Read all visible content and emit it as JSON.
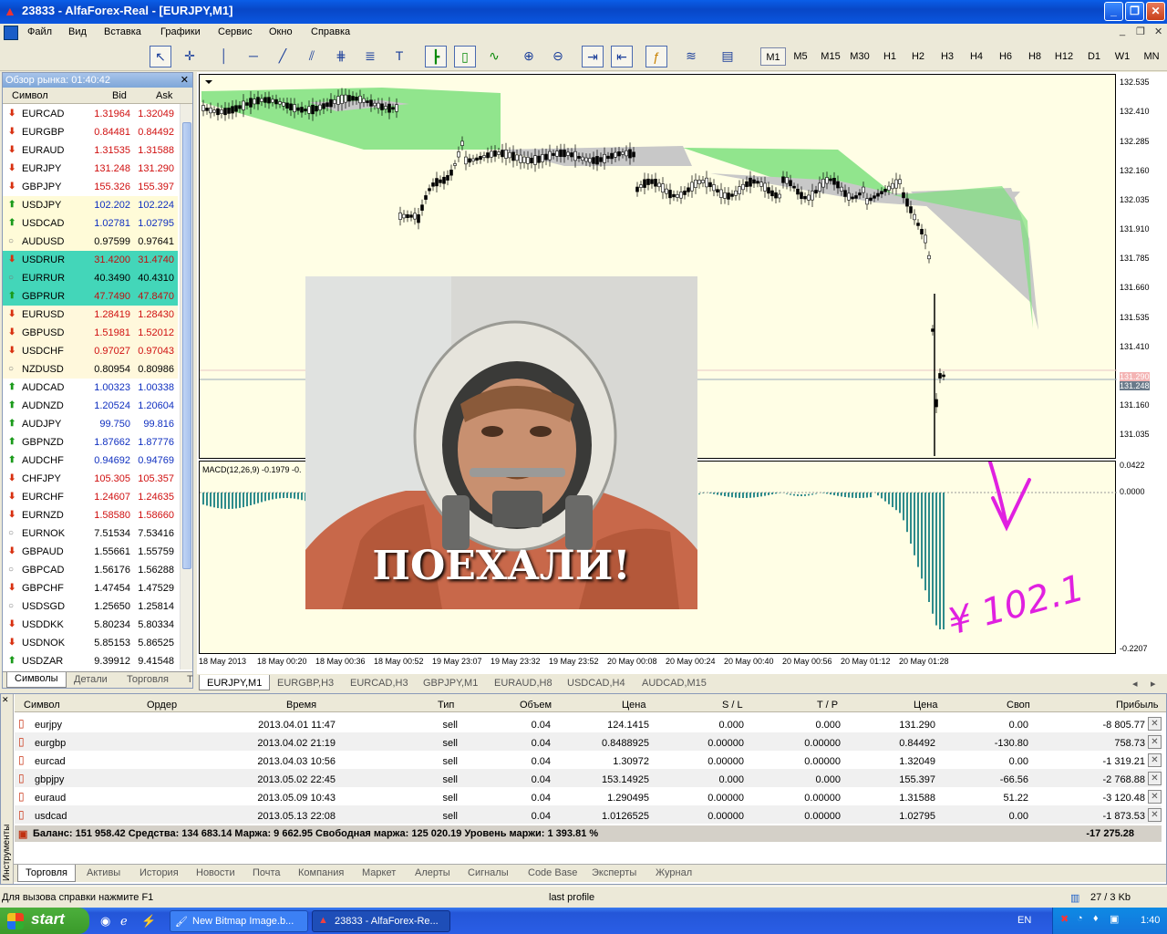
{
  "window": {
    "title": "23833 - AlfaForex-Real - [EURJPY,M1]"
  },
  "menu": [
    "Файл",
    "Вид",
    "Вставка",
    "Графики",
    "Сервис",
    "Окно",
    "Справка"
  ],
  "timeframes": [
    "M1",
    "M5",
    "M15",
    "M30",
    "H1",
    "H2",
    "H3",
    "H4",
    "H6",
    "H8",
    "H12",
    "D1",
    "W1",
    "MN"
  ],
  "market_watch": {
    "title": "Обзор рынка: 01:40:42",
    "col_symbol": "Символ",
    "col_bid": "Bid",
    "col_ask": "Ask",
    "rows": [
      {
        "s": "EURCAD",
        "b": "1.31964",
        "a": "1.32049",
        "d": "down"
      },
      {
        "s": "EURGBP",
        "b": "0.84481",
        "a": "0.84492",
        "d": "down"
      },
      {
        "s": "EURAUD",
        "b": "1.31535",
        "a": "1.31588",
        "d": "down"
      },
      {
        "s": "EURJPY",
        "b": "131.248",
        "a": "131.290",
        "d": "down"
      },
      {
        "s": "GBPJPY",
        "b": "155.326",
        "a": "155.397",
        "d": "down"
      },
      {
        "s": "USDJPY",
        "b": "102.202",
        "a": "102.224",
        "d": "up"
      },
      {
        "s": "USDCAD",
        "b": "1.02781",
        "a": "1.02795",
        "d": "up"
      },
      {
        "s": "AUDUSD",
        "b": "0.97599",
        "a": "0.97641",
        "d": "none"
      },
      {
        "s": "USDRUR",
        "b": "31.4200",
        "a": "31.4740",
        "d": "down",
        "hl": true
      },
      {
        "s": "EURRUR",
        "b": "40.3490",
        "a": "40.4310",
        "d": "none",
        "hl": true
      },
      {
        "s": "GBPRUR",
        "b": "47.7490",
        "a": "47.8470",
        "d": "up",
        "hl": true
      },
      {
        "s": "EURUSD",
        "b": "1.28419",
        "a": "1.28430",
        "d": "down"
      },
      {
        "s": "GBPUSD",
        "b": "1.51981",
        "a": "1.52012",
        "d": "down"
      },
      {
        "s": "USDCHF",
        "b": "0.97027",
        "a": "0.97043",
        "d": "down"
      },
      {
        "s": "NZDUSD",
        "b": "0.80954",
        "a": "0.80986",
        "d": "none"
      },
      {
        "s": "AUDCAD",
        "b": "1.00323",
        "a": "1.00338",
        "d": "up"
      },
      {
        "s": "AUDNZD",
        "b": "1.20524",
        "a": "1.20604",
        "d": "up"
      },
      {
        "s": "AUDJPY",
        "b": "99.750",
        "a": "99.816",
        "d": "up"
      },
      {
        "s": "GBPNZD",
        "b": "1.87662",
        "a": "1.87776",
        "d": "up"
      },
      {
        "s": "AUDCHF",
        "b": "0.94692",
        "a": "0.94769",
        "d": "up"
      },
      {
        "s": "CHFJPY",
        "b": "105.305",
        "a": "105.357",
        "d": "down"
      },
      {
        "s": "EURCHF",
        "b": "1.24607",
        "a": "1.24635",
        "d": "down"
      },
      {
        "s": "EURNZD",
        "b": "1.58580",
        "a": "1.58660",
        "d": "down"
      },
      {
        "s": "EURNOK",
        "b": "7.51534",
        "a": "7.53416",
        "d": "none"
      },
      {
        "s": "GBPAUD",
        "b": "1.55661",
        "a": "1.55759",
        "d": "down"
      },
      {
        "s": "GBPCAD",
        "b": "1.56176",
        "a": "1.56288",
        "d": "none"
      },
      {
        "s": "GBPCHF",
        "b": "1.47454",
        "a": "1.47529",
        "d": "down"
      },
      {
        "s": "USDSGD",
        "b": "1.25650",
        "a": "1.25814",
        "d": "none"
      },
      {
        "s": "USDDKK",
        "b": "5.80234",
        "a": "5.80334",
        "d": "down"
      },
      {
        "s": "USDNOK",
        "b": "5.85153",
        "a": "5.86525",
        "d": "down"
      },
      {
        "s": "USDZAR",
        "b": "9.39912",
        "a": "9.41548",
        "d": "up"
      }
    ],
    "tabs": [
      "Символы",
      "Детали",
      "Торговля",
      "Т"
    ]
  },
  "chart": {
    "price_labels": [
      "132.535",
      "132.410",
      "132.285",
      "132.160",
      "132.035",
      "131.910",
      "131.785",
      "131.660",
      "131.535",
      "131.410",
      "131.290",
      "131.248",
      "131.160",
      "131.035"
    ],
    "macd_label": "MACD(12,26,9) -0.1979 -0.",
    "macd_levels": [
      "0.0422",
      "0.0000",
      "-0.2207"
    ],
    "time_labels": [
      "18 May 2013",
      "18 May 00:20",
      "18 May 00:36",
      "18 May 00:52",
      "19 May 23:07",
      "19 May 23:32",
      "19 May 23:52",
      "20 May 00:08",
      "20 May 00:24",
      "20 May 00:40",
      "20 May 00:56",
      "20 May 01:12",
      "20 May 01:28"
    ],
    "annotation": "¥ 102.1",
    "poster_text": "ПОЕХАЛИ!",
    "up_color": "#7ee07e",
    "down_color": "#c8c8c8",
    "macd_color": "#2e8b8b",
    "annot_color": "#e020e0"
  },
  "chart_tabs": [
    "EURJPY,M1",
    "EURGBP,H3",
    "EURCAD,H3",
    "GBPJPY,M1",
    "EURAUD,H8",
    "USDCAD,H4",
    "AUDCAD,M15"
  ],
  "terminal": {
    "side_label": "Инструменты",
    "cols": [
      "Символ",
      "Ордер",
      "Время",
      "Тип",
      "Объем",
      "Цена",
      "S / L",
      "T / P",
      "Цена",
      "Своп",
      "Прибыль"
    ],
    "rows": [
      {
        "sym": "eurjpy",
        "time": "2013.04.01 11:47",
        "type": "sell",
        "vol": "0.04",
        "price": "124.1415",
        "sl": "0.000",
        "tp": "0.000",
        "cur": "131.290",
        "swap": "0.00",
        "profit": "-8 805.77"
      },
      {
        "sym": "eurgbp",
        "time": "2013.04.02 21:19",
        "type": "sell",
        "vol": "0.04",
        "price": "0.8488925",
        "sl": "0.00000",
        "tp": "0.00000",
        "cur": "0.84492",
        "swap": "-130.80",
        "profit": "758.73"
      },
      {
        "sym": "eurcad",
        "time": "2013.04.03 10:56",
        "type": "sell",
        "vol": "0.04",
        "price": "1.30972",
        "sl": "0.00000",
        "tp": "0.00000",
        "cur": "1.32049",
        "swap": "0.00",
        "profit": "-1 319.21"
      },
      {
        "sym": "gbpjpy",
        "time": "2013.05.02 22:45",
        "type": "sell",
        "vol": "0.04",
        "price": "153.14925",
        "sl": "0.000",
        "tp": "0.000",
        "cur": "155.397",
        "swap": "-66.56",
        "profit": "-2 768.88"
      },
      {
        "sym": "euraud",
        "time": "2013.05.09 10:43",
        "type": "sell",
        "vol": "0.04",
        "price": "1.290495",
        "sl": "0.00000",
        "tp": "0.00000",
        "cur": "1.31588",
        "swap": "51.22",
        "profit": "-3 120.48"
      },
      {
        "sym": "usdcad",
        "time": "2013.05.13 22:08",
        "type": "sell",
        "vol": "0.04",
        "price": "1.0126525",
        "sl": "0.00000",
        "tp": "0.00000",
        "cur": "1.02795",
        "swap": "0.00",
        "profit": "-1 873.53"
      }
    ],
    "balance": "Баланс: 151 958.42  Средства: 134 683.14  Маржа: 9 662.95  Свободная маржа: 125 020.19  Уровень маржи: 1 393.81 %",
    "total": "-17 275.28",
    "tabs": [
      "Торговля",
      "Активы",
      "История",
      "Новости",
      "Почта",
      "Компания",
      "Маркет",
      "Алерты",
      "Сигналы",
      "Code Base",
      "Эксперты",
      "Журнал"
    ]
  },
  "status": {
    "help": "Для вызова справки нажмите F1",
    "profile": "last profile",
    "traffic": "27 / 3 Kb"
  },
  "taskbar": {
    "start": "start",
    "items": [
      "New Bitmap Image.b...",
      "23833 - AlfaForex-Re..."
    ],
    "lang": "EN",
    "clock": "1:40"
  }
}
